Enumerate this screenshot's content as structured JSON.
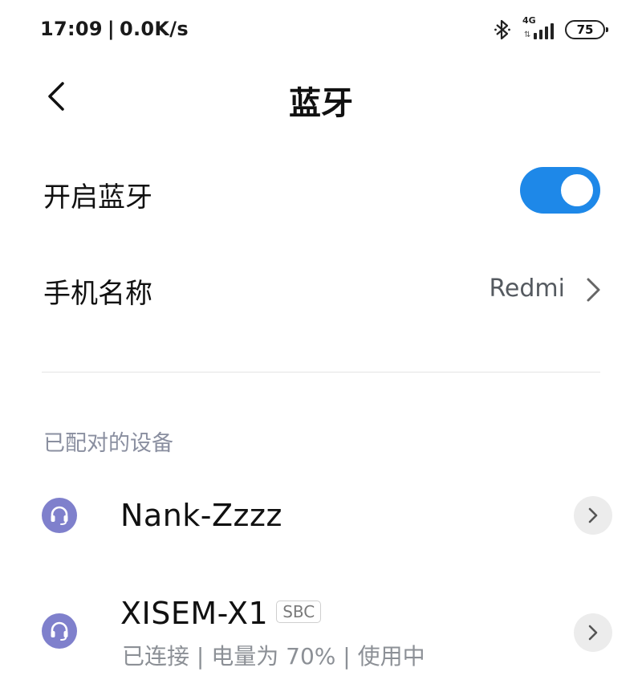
{
  "status_bar": {
    "time": "17:09",
    "separator": "|",
    "net_speed": "0.0K/s",
    "network_type": "4G",
    "battery": "75"
  },
  "header": {
    "title": "蓝牙"
  },
  "bluetooth_toggle": {
    "label": "开启蓝牙",
    "enabled": true,
    "accent_color": "#1e88e8"
  },
  "device_name_row": {
    "label": "手机名称",
    "value": "Redmi"
  },
  "paired_section": {
    "title": "已配对的设备",
    "devices": [
      {
        "name": "Nank-Zzzz",
        "icon": "headset-icon"
      },
      {
        "name": "XISEM-X1",
        "codec": "SBC",
        "status": "已连接 | 电量为 70% | 使用中",
        "icon": "headset-icon"
      }
    ]
  },
  "colors": {
    "device_icon_bg": "#7f80cc",
    "section_title": "#8a8fa0"
  }
}
